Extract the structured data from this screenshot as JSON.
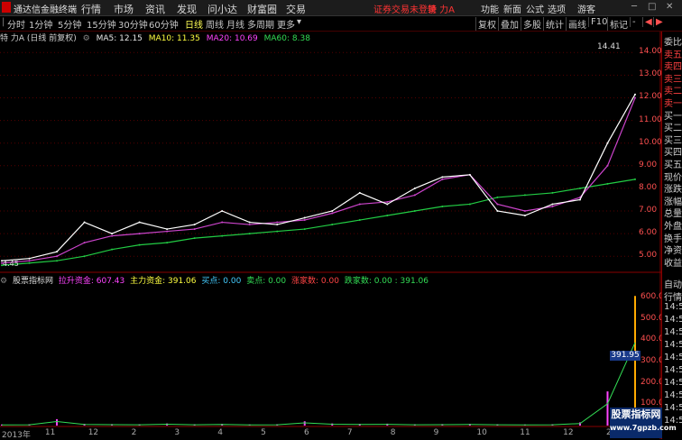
{
  "menubar": {
    "app_title": "通达信金融终端",
    "items": [
      "行情",
      "市场",
      "资讯",
      "发现",
      "问小达",
      "财富圈",
      "交易"
    ],
    "login_text": "证券交易未登录",
    "stock_text": "特 力A",
    "right_items": [
      "功能",
      "新面",
      "公式",
      "选项",
      "游客"
    ]
  },
  "toolbar": {
    "periods": [
      "分时",
      "1分钟",
      "5分钟",
      "15分钟",
      "30分钟",
      "60分钟",
      "日线",
      "周线",
      "月线",
      "多周期",
      "更多"
    ],
    "active": "日线",
    "right_buttons": [
      "复权",
      "叠加",
      "多股",
      "统计",
      "画线",
      "F10",
      "标记",
      "-"
    ]
  },
  "ma_header": {
    "title": "特 力A (日线 前复权)",
    "ma5": "MA5: 12.15",
    "ma10": "MA10: 11.35",
    "ma20": "MA20: 10.69",
    "ma60": "MA60: 8.38"
  },
  "price_axis": {
    "labels": [
      "14.00",
      "13.00",
      "12.00",
      "11.00",
      "10.00",
      "9.00",
      "8.00",
      "7.00",
      "6.00",
      "5.00"
    ],
    "high_marker": "14.41",
    "low_marker": "4.45"
  },
  "indicator_header": {
    "name": "股票指标网",
    "a": "拉升资金: 607.43",
    "b": "主力资金: 391.06",
    "c": "买点: 0.00",
    "d": "卖点: 0.00",
    "e": "涨家数: 0.00",
    "f": "跌家数: 0.00 : 391.06"
  },
  "indicator_axis": {
    "labels": [
      "600.0",
      "500.0",
      "400.0",
      "300.0",
      "200.0",
      "100.0"
    ],
    "current": "391.95"
  },
  "right_panel": {
    "top_items": [
      "委比",
      "卖五",
      "卖四",
      "卖三",
      "卖二",
      "卖一",
      "买一",
      "买二",
      "买三",
      "买四",
      "买五",
      "现价",
      "涨跌",
      "涨幅",
      "总量",
      "外盘",
      "换手",
      "净资",
      "收益"
    ],
    "lower_items": [
      "自动",
      "行情",
      "14:5",
      "14:5",
      "14:5",
      "14:5",
      "14:5",
      "14:5",
      "14:5",
      "14:5",
      "14:5",
      "14:5"
    ]
  },
  "x_axis": {
    "labels": [
      "2013年",
      "11",
      "12",
      "2",
      "3",
      "4",
      "5",
      "6",
      "7",
      "8",
      "9",
      "10",
      "11",
      "12",
      "2"
    ]
  },
  "watermark": {
    "line1": "股票指标网",
    "line2": "www.7gpzb.com"
  },
  "chart_data": {
    "type": "line",
    "title": "",
    "series": [
      {
        "name": "MA60",
        "color": "#22cc44",
        "values": [
          4.6,
          4.7,
          4.8,
          5.0,
          5.3,
          5.5,
          5.6,
          5.8,
          5.9,
          6.0,
          6.1,
          6.2,
          6.4,
          6.6,
          6.8,
          7.0,
          7.2,
          7.3,
          7.6,
          7.7,
          7.8,
          8.0,
          8.2,
          8.4
        ]
      },
      {
        "name": "MA20",
        "color": "#cc44cc",
        "values": [
          4.7,
          4.8,
          5.0,
          5.6,
          5.9,
          6.0,
          6.1,
          6.2,
          6.5,
          6.4,
          6.5,
          6.6,
          6.9,
          7.3,
          7.4,
          7.7,
          8.4,
          8.6,
          7.3,
          7.0,
          7.2,
          7.6,
          9.0,
          12.0
        ]
      },
      {
        "name": "MA5",
        "color": "#ffffff",
        "values": [
          4.8,
          4.9,
          5.2,
          6.5,
          6.0,
          6.5,
          6.2,
          6.4,
          7.0,
          6.5,
          6.4,
          6.7,
          7.0,
          7.8,
          7.3,
          8.0,
          8.5,
          8.6,
          7.0,
          6.8,
          7.3,
          7.5,
          10.0,
          12.15
        ]
      }
    ],
    "ylim": [
      4.45,
      14.41
    ],
    "indicator": {
      "name": "主力资金",
      "values": [
        5,
        6,
        30,
        8,
        7,
        6,
        10,
        6,
        8,
        5,
        6,
        20,
        10,
        8,
        9,
        6,
        7,
        8,
        6,
        5,
        6,
        15,
        160,
        607
      ]
    }
  }
}
